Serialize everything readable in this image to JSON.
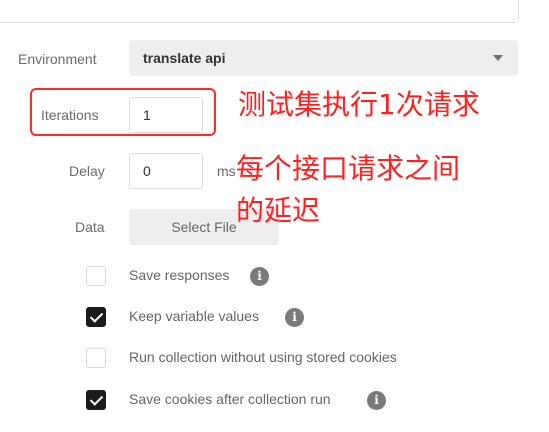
{
  "environment": {
    "label": "Environment",
    "value": "translate api"
  },
  "iterations": {
    "label": "Iterations",
    "value": "1"
  },
  "delay": {
    "label": "Delay",
    "value": "0",
    "unit": "ms"
  },
  "data": {
    "label": "Data",
    "button": "Select File"
  },
  "options": [
    {
      "label": "Save responses",
      "checked": false,
      "info": true
    },
    {
      "label": "Keep variable values",
      "checked": true,
      "info": true
    },
    {
      "label": "Run collection without using stored cookies",
      "checked": false,
      "info": false
    },
    {
      "label": "Save cookies after collection run",
      "checked": true,
      "info": true
    }
  ],
  "annotations": {
    "iterations_note": "测试集执行1次请求",
    "delay_note_line1": "每个接口请求之间",
    "delay_note_line2": "的延迟"
  },
  "colors": {
    "annotation": "#ff2020",
    "checkbox_checked": "#1b1b1b"
  }
}
